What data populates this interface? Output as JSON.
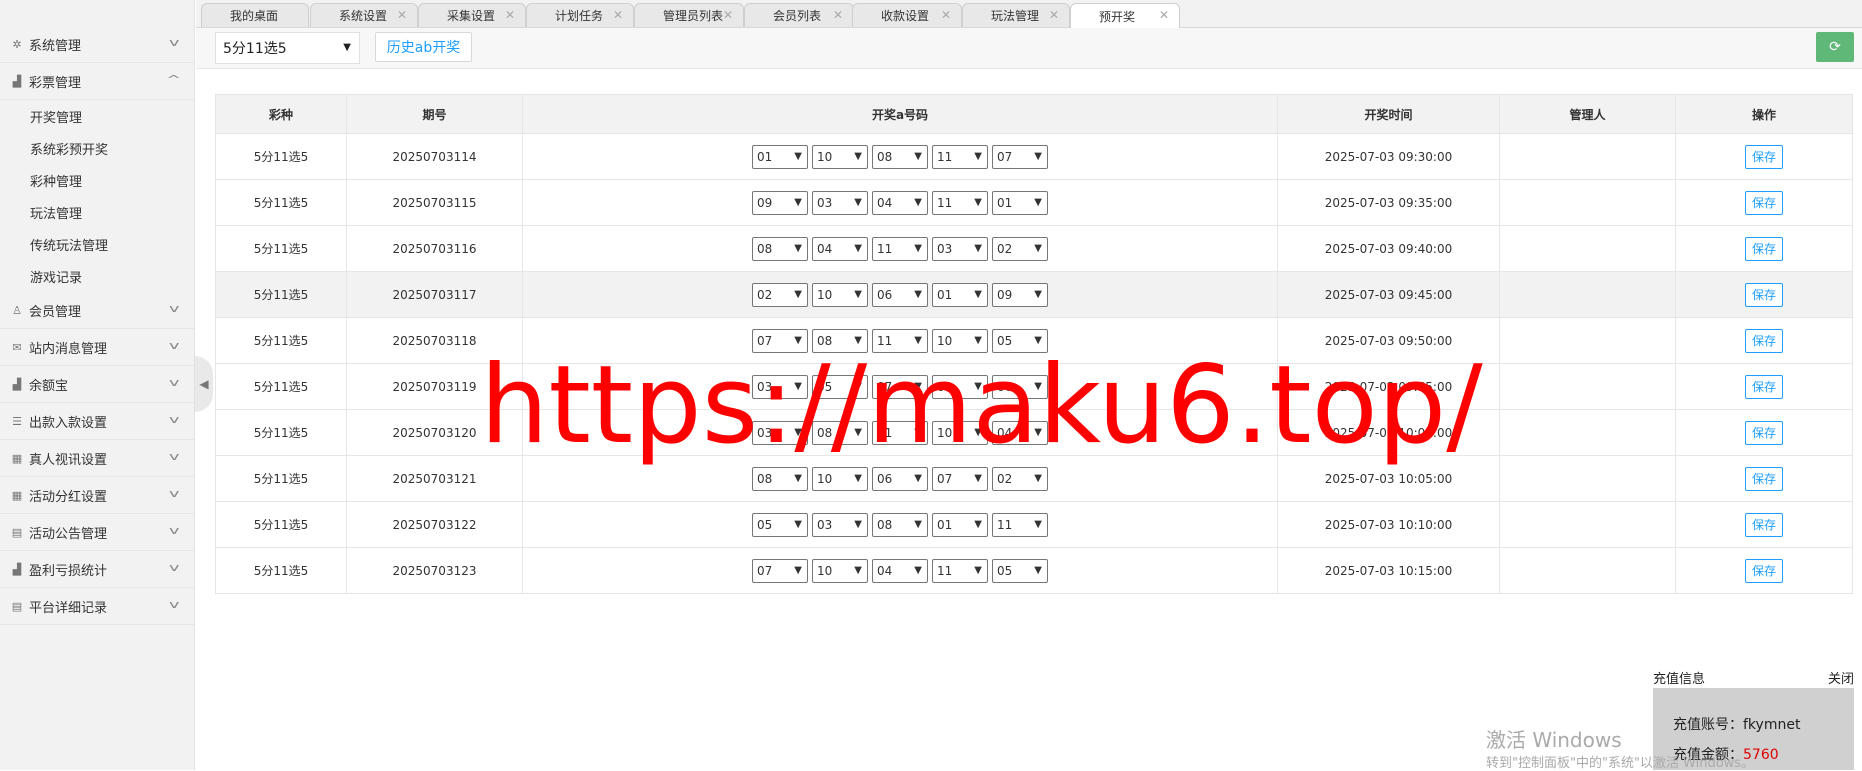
{
  "tabs": [
    {
      "label": "我的桌面"
    },
    {
      "label": "系统设置"
    },
    {
      "label": "采集设置"
    },
    {
      "label": "计划任务"
    },
    {
      "label": "管理员列表"
    },
    {
      "label": "会员列表"
    },
    {
      "label": "收款设置"
    },
    {
      "label": "玩法管理"
    },
    {
      "label": "预开奖"
    }
  ],
  "sidebar": {
    "items": [
      {
        "label": "系统管理",
        "icon": "gear-icon"
      },
      {
        "label": "彩票管理",
        "icon": "chart-icon",
        "expanded": true
      },
      {
        "label": "会员管理",
        "icon": "user-icon"
      },
      {
        "label": "站内消息管理",
        "icon": "mail-icon"
      },
      {
        "label": "余额宝",
        "icon": "chart-icon"
      },
      {
        "label": "出款入款设置",
        "icon": "list-icon"
      },
      {
        "label": "真人视讯设置",
        "icon": "grid-icon"
      },
      {
        "label": "活动分红设置",
        "icon": "grid-icon"
      },
      {
        "label": "活动公告管理",
        "icon": "stack-icon"
      },
      {
        "label": "盈利亏损统计",
        "icon": "chart-icon"
      },
      {
        "label": "平台详细记录",
        "icon": "stack-icon"
      }
    ],
    "subitems": [
      {
        "label": "开奖管理"
      },
      {
        "label": "系统彩预开奖"
      },
      {
        "label": "彩种管理"
      },
      {
        "label": "玩法管理"
      },
      {
        "label": "传统玩法管理"
      },
      {
        "label": "游戏记录"
      }
    ]
  },
  "toolbar": {
    "lottery_select": "5分11选5",
    "history_button": "历史ab开奖"
  },
  "table": {
    "headers": [
      "彩种",
      "期号",
      "开奖a号码",
      "开奖时间",
      "管理人",
      "操作"
    ],
    "save_label": "保存",
    "rows": [
      {
        "lottery": "5分11选5",
        "period": "20250703114",
        "numbers": [
          "01",
          "10",
          "08",
          "11",
          "07"
        ],
        "time": "2025-07-03 09:30:00",
        "manager": ""
      },
      {
        "lottery": "5分11选5",
        "period": "20250703115",
        "numbers": [
          "09",
          "03",
          "04",
          "11",
          "01"
        ],
        "time": "2025-07-03 09:35:00",
        "manager": ""
      },
      {
        "lottery": "5分11选5",
        "period": "20250703116",
        "numbers": [
          "08",
          "04",
          "11",
          "03",
          "02"
        ],
        "time": "2025-07-03 09:40:00",
        "manager": ""
      },
      {
        "lottery": "5分11选5",
        "period": "20250703117",
        "numbers": [
          "02",
          "10",
          "06",
          "01",
          "09"
        ],
        "time": "2025-07-03 09:45:00",
        "manager": ""
      },
      {
        "lottery": "5分11选5",
        "period": "20250703118",
        "numbers": [
          "07",
          "08",
          "11",
          "10",
          "05"
        ],
        "time": "2025-07-03 09:50:00",
        "manager": ""
      },
      {
        "lottery": "5分11选5",
        "period": "20250703119",
        "numbers": [
          "03",
          "05",
          "07",
          "01",
          "06"
        ],
        "time": "2025-07-03 09:55:00",
        "manager": ""
      },
      {
        "lottery": "5分11选5",
        "period": "20250703120",
        "numbers": [
          "03",
          "08",
          "11",
          "10",
          "04"
        ],
        "time": "2025-07-03 10:00:00",
        "manager": ""
      },
      {
        "lottery": "5分11选5",
        "period": "20250703121",
        "numbers": [
          "08",
          "10",
          "06",
          "07",
          "02"
        ],
        "time": "2025-07-03 10:05:00",
        "manager": ""
      },
      {
        "lottery": "5分11选5",
        "period": "20250703122",
        "numbers": [
          "05",
          "03",
          "08",
          "01",
          "11"
        ],
        "time": "2025-07-03 10:10:00",
        "manager": ""
      },
      {
        "lottery": "5分11选5",
        "period": "20250703123",
        "numbers": [
          "07",
          "10",
          "04",
          "11",
          "05"
        ],
        "time": "2025-07-03 10:15:00",
        "manager": ""
      }
    ]
  },
  "watermark": "https://maku6.top/",
  "recharge": {
    "title": "充值信息",
    "close": "关闭",
    "account_label": "充值账号：",
    "account": "fkymnet",
    "amount_label": "充值金额：",
    "amount": "5760"
  },
  "windows_activation": {
    "title": "激活 Windows",
    "subtitle": "转到\"控制面板\"中的\"系统\"以激活 Windows。"
  },
  "colors": {
    "accent": "#1E9FFF",
    "refresh": "#5FB878",
    "watermark": "#ff0000"
  }
}
